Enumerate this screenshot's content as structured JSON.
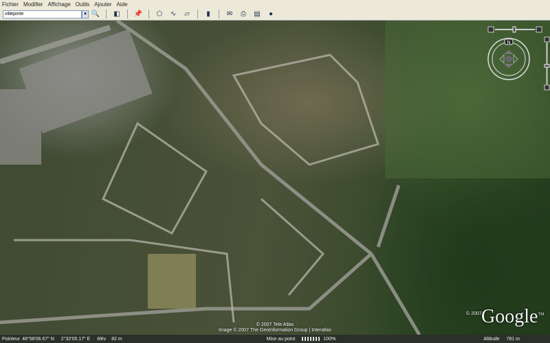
{
  "menu": [
    "Fichier",
    "Modifier",
    "Affichage",
    "Outils",
    "Ajouter",
    "Aide"
  ],
  "search": {
    "value": "villepinte"
  },
  "toolbar_icons": [
    "search-icon",
    "sidebar-toggle-icon",
    "placemark-icon",
    "polygon-icon",
    "path-icon",
    "image-overlay-icon",
    "ruler-icon",
    "email-icon",
    "print-icon",
    "google-maps-icon",
    "sky-icon"
  ],
  "attribution": {
    "line1": "© 2007 Tele Atlas",
    "line2": "Image © 2007 The GeoInformation Group | Interatlas"
  },
  "logo": {
    "copyright": "© 2007",
    "text": "Google",
    "tm": "TM"
  },
  "compass": {
    "north": "N"
  },
  "status": {
    "pointer_label": "Pointeur",
    "lat": "48°58'06.67\" N",
    "lon": "2°32'05.17\" E",
    "elev_label": "élév",
    "elev": "82 m",
    "focus": "Mise au point",
    "streaming": "100%",
    "altitude_label": "Altitude",
    "altitude": "781 m"
  }
}
